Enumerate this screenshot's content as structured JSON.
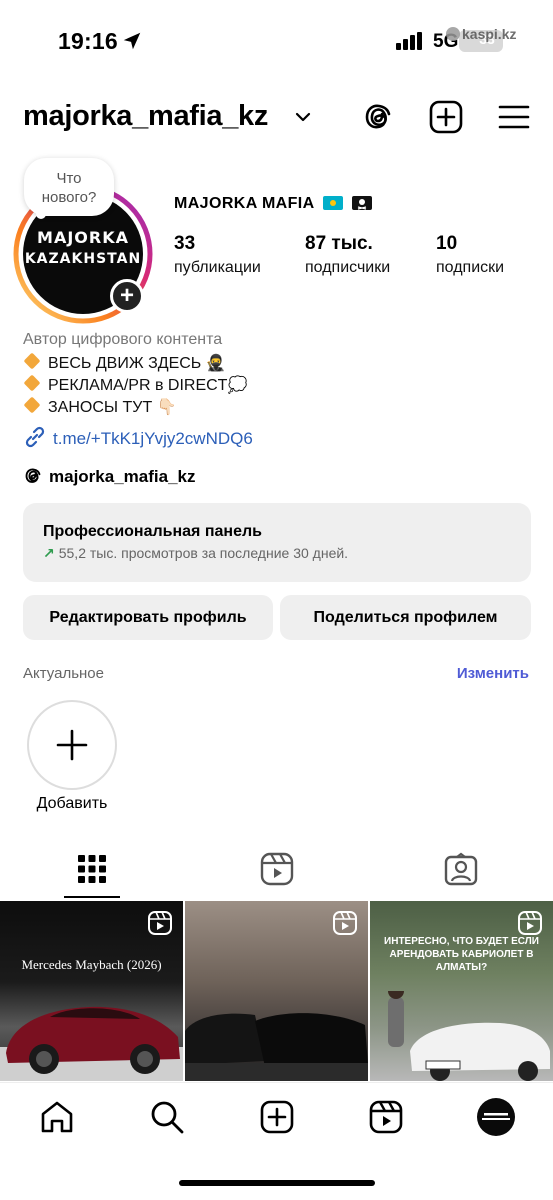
{
  "status_bar": {
    "time": "19:16",
    "network": "5G",
    "battery": "33",
    "watermark": "kaspi.kz"
  },
  "header": {
    "username": "majorka_mafia_kz",
    "icons": [
      "chevron-down-icon",
      "threads-icon",
      "new-post-icon",
      "menu-icon"
    ]
  },
  "profile": {
    "note_bubble": "Что нового?",
    "avatar_text_line1": "MAJORKA",
    "avatar_text_line2": "KAZAKHSTAN",
    "display_name": "MAJORKA MAFIA",
    "stats": {
      "posts_value": "33",
      "posts_label": "публикации",
      "followers_value": "87 тыс.",
      "followers_label": "подписчики",
      "following_value": "10",
      "following_label": "подписки"
    },
    "category": "Автор цифрового контента",
    "bio": [
      "ВЕСЬ ДВИЖ ЗДЕСЬ 🥷",
      "РЕКЛАМА/PR в DIRECT💭",
      "ЗАНОСЫ ТУТ 👇🏻"
    ],
    "link": "t.me/+TkK1jYvjy2cwNDQ6",
    "threads_handle": "majorka_mafia_kz"
  },
  "pro_panel": {
    "title": "Профессиональная панель",
    "subtitle": "55,2 тыс. просмотров за последние 30 дней."
  },
  "buttons": {
    "edit_profile": "Редактировать профиль",
    "share_profile": "Поделиться профилем"
  },
  "highlights": {
    "label": "Актуальное",
    "edit": "Изменить",
    "add_label": "Добавить"
  },
  "tabs": [
    "grid-icon",
    "reels-icon",
    "tagged-icon"
  ],
  "grid": [
    {
      "caption": "Mercedes Maybach (2026)"
    },
    {
      "caption": ""
    },
    {
      "caption": "ИНТЕРЕСНО, ЧТО БУДЕТ ЕСЛИ АРЕНДОВАТЬ КАБРИОЛЕТ В АЛМАТЫ?"
    }
  ],
  "bottom_nav": [
    "home-icon",
    "search-icon",
    "create-icon",
    "reels-icon",
    "profile-avatar"
  ],
  "colors": {
    "link": "#2c5fb8",
    "accent": "#4f5bd5",
    "panel_bg": "#efefef",
    "growth_arrow": "#2e9b4e"
  }
}
